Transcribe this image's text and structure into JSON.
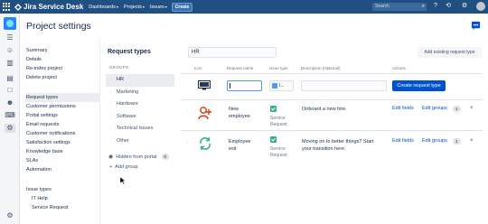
{
  "topbar": {
    "app_name": "Jira Service Desk",
    "nav": [
      {
        "label": "Dashboards"
      },
      {
        "label": "Projects"
      },
      {
        "label": "Issues"
      }
    ],
    "create_label": "Create",
    "search_placeholder": "Search"
  },
  "page_title": "Project settings",
  "sidebar": {
    "group1": [
      "Summary",
      "Details",
      "Re-index project",
      "Delete project"
    ],
    "group2": [
      "Request types",
      "Customer permissions",
      "Portal settings",
      "Email requests",
      "Customer notifications",
      "Satisfaction settings",
      "Knowledge base",
      "SLAs",
      "Automation"
    ],
    "group3_header": "Issue types",
    "group3": [
      "IT Help",
      "Service Request"
    ]
  },
  "request_types": {
    "title": "Request types",
    "groups_label": "GROUPS",
    "groups": [
      "HR",
      "Marketing",
      "Hardware",
      "Software",
      "Technical Issues",
      "Other"
    ],
    "hidden_label": "Hidden from portal",
    "hidden_count": "0",
    "add_group_label": "Add group"
  },
  "main": {
    "search_value": "HR",
    "add_existing_label": "Add existing request type",
    "columns": {
      "icon": "Icon",
      "name": "Request name",
      "type": "Issue type",
      "desc": "Description (Optional)",
      "actions": "Actions"
    },
    "new_row": {
      "type_value": "I...",
      "create_label": "Create request type"
    },
    "rows": [
      {
        "name_line1": "New",
        "name_line2": "employee",
        "type_line1": "Service",
        "type_line2": "Request",
        "desc_line1": "Onboard a new hire.",
        "desc_line2": "",
        "edit_fields": "Edit fields",
        "edit_groups": "Edit groups",
        "group_count": "1"
      },
      {
        "name_line1": "Employee",
        "name_line2": "exit",
        "type_line1": "Service",
        "type_line2": "Request",
        "desc_line1": "Moving on to better things? Start",
        "desc_line2": "your transition here.",
        "edit_fields": "Edit fields",
        "edit_groups": "Edit groups",
        "group_count": "1"
      }
    ]
  },
  "colors": {
    "topbar": "#205081",
    "primary": "#0052cc",
    "link": "#0052cc",
    "success": "#36b37e"
  }
}
